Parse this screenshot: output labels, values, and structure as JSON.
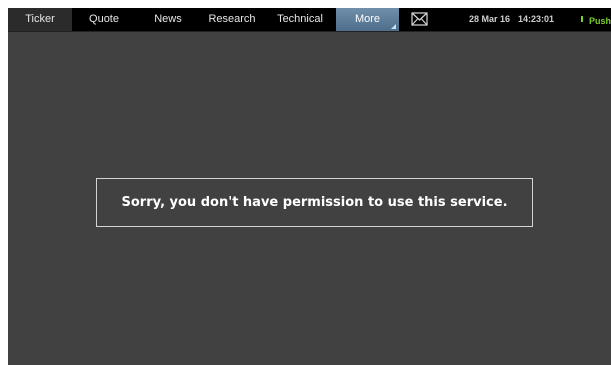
{
  "nav": {
    "tabs": [
      {
        "label": "Ticker"
      },
      {
        "label": "Quote"
      },
      {
        "label": "News"
      },
      {
        "label": "Research"
      },
      {
        "label": "Technical"
      },
      {
        "label": "More"
      }
    ],
    "active_tab": "More",
    "mail_icon": "envelope-icon",
    "date": "28 Mar 16",
    "time": "14:23:01",
    "push_label": "Push"
  },
  "colors": {
    "background": "#414141",
    "navbar": "#000000",
    "active_tab": "#5a7b98",
    "push_indicator": "#7ccf2a",
    "message_border": "#d4d4d4"
  },
  "message": {
    "text": "Sorry, you don't have permission to use this service."
  }
}
